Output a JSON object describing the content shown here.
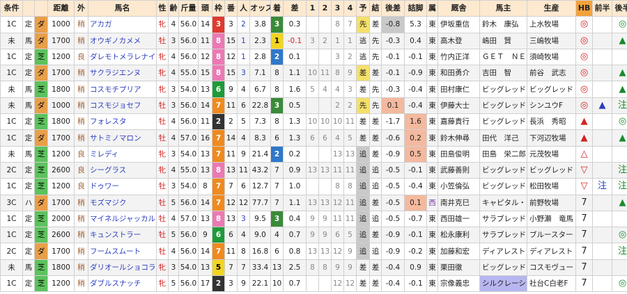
{
  "headers": [
    "条件",
    "",
    "",
    "距離",
    "外",
    "馬名",
    "性",
    "齢",
    "斤量",
    "頭",
    "枠",
    "番",
    "人",
    "オッズ",
    "着",
    "差",
    "1",
    "2",
    "3",
    "4",
    "予",
    "結",
    "後差",
    "詰脚",
    "属",
    "厩舎",
    "馬主",
    "生産",
    "HB",
    "前半",
    "後半"
  ],
  "waku_colors": {
    "1": {
      "bg": "#ffffff",
      "fg": "#000000"
    },
    "2": {
      "bg": "#333333",
      "fg": "#ffffff"
    },
    "3": {
      "bg": "#e03a2e",
      "fg": "#ffffff"
    },
    "4": {
      "bg": "#2f63c9",
      "fg": "#ffffff"
    },
    "5": {
      "bg": "#f1d520",
      "fg": "#000000"
    },
    "6": {
      "bg": "#1f9a3a",
      "fg": "#ffffff"
    },
    "7": {
      "bg": "#f08a1e",
      "fg": "#ffffff"
    },
    "8": {
      "bg": "#ec79b4",
      "fg": "#ffffff"
    }
  },
  "finish_colors": {
    "1": {
      "bg": "#f1d520",
      "fg": "#000000"
    },
    "2": {
      "bg": "#2f78c9",
      "fg": "#ffffff"
    },
    "3": {
      "bg": "#3a8a3a",
      "fg": "#ffffff"
    },
    "other": {
      "bg": "",
      "fg": "#222222"
    }
  },
  "rows": [
    {
      "cls": "1C",
      "kind": "定",
      "surf": "ダ",
      "dist": "1000",
      "soto": "稍",
      "name": "アカガ",
      "sex": "牝",
      "age": "4",
      "kin": "56.0",
      "tou": "14",
      "waku": "3",
      "ban": "3",
      "nin": "2",
      "odds": "3.8",
      "chaku": "3",
      "sa": "0.3",
      "c1": "",
      "c2": "",
      "c3": "8",
      "c4": "7",
      "yo": "先",
      "yo_style": "cell-yellow",
      "ketsu": "差",
      "gosa": "-0.8",
      "gosa_style": "cell-gray",
      "tsume": "5.3",
      "tsume_style": "",
      "zoku": "東",
      "kyu": "伊坂重信",
      "owner": "鈴木　康弘",
      "owner_style": "",
      "sei": "上水牧場",
      "hb": "◎",
      "hb_cls": "mark-red",
      "zen": "",
      "kou": "◎",
      "kou_cls": "mark-green"
    },
    {
      "cls": "未",
      "kind": "馬",
      "surf": "ダ",
      "dist": "1700",
      "soto": "稍",
      "name": "オウギノカメメ",
      "sex": "牡",
      "age": "3",
      "kin": "56.0",
      "tou": "11",
      "waku": "8",
      "ban": "15",
      "nin": "1",
      "odds": "2.3",
      "chaku": "1",
      "sa": "-0.1",
      "c1": "3",
      "c2": "2",
      "c3": "1",
      "c4": "1",
      "yo": "逃",
      "yo_style": "",
      "ketsu": "先",
      "gosa": "-0.3",
      "gosa_style": "",
      "tsume": "0.4",
      "tsume_style": "",
      "zoku": "東",
      "kyu": "高木登",
      "owner": "嶋田　賢",
      "owner_style": "",
      "sei": "三嶋牧場",
      "hb": "◎",
      "hb_cls": "mark-red",
      "zen": "",
      "kou": "▲",
      "kou_cls": "mark-green"
    },
    {
      "cls": "1C",
      "kind": "定",
      "surf": "芝",
      "dist": "1200",
      "soto": "良",
      "name": "ダレモトメラレナイ",
      "sex": "牝",
      "age": "4",
      "kin": "56.0",
      "tou": "12",
      "waku": "8",
      "ban": "12",
      "nin": "1",
      "odds": "2.8",
      "chaku": "2",
      "sa": "0.1",
      "c1": "",
      "c2": "",
      "c3": "3",
      "c4": "2",
      "yo": "逃",
      "yo_style": "",
      "ketsu": "先",
      "gosa": "-0.1",
      "gosa_style": "",
      "tsume": "-0.1",
      "tsume_style": "",
      "zoku": "東",
      "kyu": "竹内正洋",
      "owner": "ＧＥＴ　ＮＥ",
      "owner_style": "",
      "sei": "須崎牧場",
      "hb": "◎",
      "hb_cls": "mark-red",
      "zen": "",
      "kou": "",
      "kou_cls": ""
    },
    {
      "cls": "1C",
      "kind": "定",
      "surf": "ダ",
      "dist": "1700",
      "soto": "稍",
      "name": "サクラジエンヌ",
      "sex": "牝",
      "age": "4",
      "kin": "55.0",
      "tou": "15",
      "waku": "8",
      "ban": "15",
      "nin": "3",
      "odds": "7.1",
      "chaku": "8",
      "sa": "1.1",
      "c1": "10",
      "c2": "11",
      "c3": "8",
      "c4": "9",
      "yo": "差",
      "yo_style": "cell-yellow",
      "ketsu": "差",
      "gosa": "-0.1",
      "gosa_style": "",
      "tsume": "-0.9",
      "tsume_style": "",
      "zoku": "東",
      "kyu": "和田勇介",
      "owner": "吉田　智",
      "owner_style": "",
      "sei": "前谷　武志",
      "hb": "◎",
      "hb_cls": "mark-red",
      "zen": "",
      "kou": "▲",
      "kou_cls": "mark-green"
    },
    {
      "cls": "未",
      "kind": "馬",
      "surf": "芝",
      "dist": "1800",
      "soto": "稍",
      "name": "コスモチプリア",
      "sex": "牝",
      "age": "3",
      "kin": "54.0",
      "tou": "13",
      "waku": "6",
      "ban": "9",
      "nin": "4",
      "odds": "6.7",
      "chaku": "8",
      "sa": "1.6",
      "c1": "5",
      "c2": "4",
      "c3": "4",
      "c4": "3",
      "yo": "差",
      "yo_style": "",
      "ketsu": "先",
      "gosa": "-0.3",
      "gosa_style": "",
      "tsume": "-0.4",
      "tsume_style": "",
      "zoku": "東",
      "kyu": "田村康仁",
      "owner": "ビッグレッド",
      "owner_style": "",
      "sei": "ビッグレッド",
      "hb": "◎",
      "hb_cls": "mark-red",
      "zen": "",
      "kou": "▲",
      "kou_cls": "mark-green"
    },
    {
      "cls": "未",
      "kind": "馬",
      "surf": "ダ",
      "dist": "1000",
      "soto": "稍",
      "name": "コスモジョセフ",
      "sex": "牡",
      "age": "3",
      "kin": "56.0",
      "tou": "14",
      "waku": "7",
      "ban": "11",
      "nin": "6",
      "odds": "22.8",
      "chaku": "3",
      "sa": "0.5",
      "c1": "",
      "c2": "",
      "c3": "2",
      "c4": "2",
      "yo": "先",
      "yo_style": "cell-yellow",
      "ketsu": "先",
      "gosa": "0.1",
      "gosa_style": "cell-salmon",
      "tsume": "-0.4",
      "tsume_style": "",
      "zoku": "東",
      "kyu": "伊藤大士",
      "owner": "ビッグレッド",
      "owner_style": "",
      "sei": "シンユウF",
      "hb": "◎",
      "hb_cls": "mark-red",
      "zen": "▲",
      "zen_cls": "mark-blue",
      "kou": "注",
      "kou_cls": "mark-green"
    },
    {
      "cls": "1C",
      "kind": "定",
      "surf": "芝",
      "dist": "1800",
      "soto": "稍",
      "name": "フォレスタ",
      "sex": "牡",
      "age": "4",
      "kin": "56.0",
      "tou": "11",
      "waku": "2",
      "ban": "2",
      "nin": "5",
      "odds": "7.3",
      "chaku": "8",
      "sa": "1.3",
      "c1": "10",
      "c2": "10",
      "c3": "10",
      "c4": "11",
      "yo": "差",
      "yo_style": "",
      "ketsu": "差",
      "gosa": "-1.7",
      "gosa_style": "",
      "tsume": "1.6",
      "tsume_style": "cell-salmon",
      "zoku": "東",
      "kyu": "嘉藤貴行",
      "owner": "ビッグレッド",
      "owner_style": "",
      "sei": "長浜　秀昭",
      "hb": "▲",
      "hb_cls": "mark-red",
      "zen": "",
      "kou": "◎",
      "kou_cls": "mark-green"
    },
    {
      "cls": "1C",
      "kind": "定",
      "surf": "ダ",
      "dist": "1700",
      "soto": "稍",
      "name": "サトミノマロン",
      "sex": "牡",
      "age": "4",
      "kin": "57.0",
      "tou": "16",
      "waku": "7",
      "ban": "14",
      "nin": "4",
      "odds": "8.3",
      "chaku": "6",
      "sa": "1.3",
      "c1": "6",
      "c2": "6",
      "c3": "4",
      "c4": "5",
      "yo": "差",
      "yo_style": "",
      "ketsu": "差",
      "gosa": "-0.6",
      "gosa_style": "",
      "tsume": "0.2",
      "tsume_style": "cell-salmon",
      "zoku": "東",
      "kyu": "鈴木伸尋",
      "owner": "田代　洋己",
      "owner_style": "",
      "sei": "下河辺牧場",
      "hb": "▲",
      "hb_cls": "mark-red",
      "zen": "",
      "kou": "▲",
      "kou_cls": "mark-green"
    },
    {
      "cls": "未",
      "kind": "馬",
      "surf": "芝",
      "dist": "1200",
      "soto": "良",
      "name": "ミレディ",
      "sex": "牝",
      "age": "3",
      "kin": "54.0",
      "tou": "13",
      "waku": "7",
      "ban": "11",
      "nin": "9",
      "odds": "21.4",
      "chaku": "2",
      "sa": "0.2",
      "c1": "",
      "c2": "",
      "c3": "13",
      "c4": "13",
      "yo": "追",
      "yo_style": "cell-gray",
      "ketsu": "差",
      "gosa": "-0.9",
      "gosa_style": "",
      "tsume": "0.5",
      "tsume_style": "cell-salmon",
      "zoku": "東",
      "kyu": "田島俊明",
      "owner": "田島　栄二郎",
      "owner_style": "",
      "sei": "元茂牧場",
      "hb": "△",
      "hb_cls": "mark-red",
      "zen": "",
      "kou": "",
      "kou_cls": ""
    },
    {
      "cls": "2C",
      "kind": "定",
      "surf": "芝",
      "dist": "2600",
      "soto": "良",
      "name": "シーグラス",
      "sex": "牝",
      "age": "4",
      "kin": "55.0",
      "tou": "13",
      "waku": "8",
      "ban": "13",
      "nin": "11",
      "odds": "43.2",
      "chaku": "7",
      "sa": "0.9",
      "c1": "13",
      "c2": "13",
      "c3": "11",
      "c4": "11",
      "yo": "追",
      "yo_style": "cell-gray",
      "ketsu": "追",
      "gosa": "-0.5",
      "gosa_style": "",
      "tsume": "-0.1",
      "tsume_style": "",
      "zoku": "東",
      "kyu": "武藤善則",
      "owner": "ビッグレッド",
      "owner_style": "",
      "sei": "ビッグレッド",
      "hb": "▽",
      "hb_cls": "mark-red",
      "zen": "",
      "kou": "注",
      "kou_cls": "mark-green"
    },
    {
      "cls": "1C",
      "kind": "定",
      "surf": "芝",
      "dist": "1200",
      "soto": "良",
      "name": "ドゥワー",
      "sex": "牡",
      "age": "3",
      "kin": "54.0",
      "tou": "8",
      "waku": "7",
      "ban": "7",
      "nin": "6",
      "odds": "12.7",
      "chaku": "7",
      "sa": "1.0",
      "c1": "",
      "c2": "",
      "c3": "8",
      "c4": "8",
      "yo": "追",
      "yo_style": "cell-gray",
      "ketsu": "追",
      "gosa": "-0.5",
      "gosa_style": "",
      "tsume": "-0.4",
      "tsume_style": "",
      "zoku": "東",
      "kyu": "小笠倫弘",
      "owner": "ビッグレッド",
      "owner_style": "",
      "sei": "松田牧場",
      "hb": "▽",
      "hb_cls": "mark-red",
      "zen": "注",
      "zen_cls": "mark-blue",
      "kou": "注",
      "kou_cls": "mark-green"
    },
    {
      "cls": "3C",
      "kind": "ハ",
      "surf": "ダ",
      "dist": "1700",
      "soto": "稍",
      "name": "モズマジク",
      "sex": "牡",
      "age": "5",
      "kin": "56.0",
      "tou": "14",
      "waku": "7",
      "ban": "12",
      "nin": "12",
      "odds": "77.7",
      "chaku": "7",
      "sa": "1.1",
      "c1": "13",
      "c2": "13",
      "c3": "12",
      "c4": "11",
      "yo": "追",
      "yo_style": "cell-gray",
      "ketsu": "差",
      "gosa": "-0.5",
      "gosa_style": "",
      "tsume": "0.1",
      "tsume_style": "cell-salmon",
      "zoku": "西",
      "zoku_cls": "purpletxt",
      "kyu": "南井克巳",
      "owner": "キャピタル・",
      "owner_style": "",
      "sei": "前野牧場",
      "hb": "7",
      "hb_cls": "",
      "zen": "",
      "kou": "▲",
      "kou_cls": "mark-green"
    },
    {
      "cls": "1C",
      "kind": "定",
      "surf": "芝",
      "dist": "2000",
      "soto": "稍",
      "name": "マイネルジャッカル",
      "sex": "牡",
      "age": "4",
      "kin": "57.0",
      "tou": "13",
      "waku": "8",
      "ban": "13",
      "nin": "3",
      "odds": "9.5",
      "chaku": "3",
      "sa": "0.4",
      "c1": "9",
      "c2": "9",
      "c3": "11",
      "c4": "11",
      "yo": "追",
      "yo_style": "cell-gray",
      "ketsu": "追",
      "gosa": "-0.5",
      "gosa_style": "",
      "tsume": "-0.7",
      "tsume_style": "",
      "zoku": "東",
      "kyu": "西田雄一",
      "owner": "サラブレッド",
      "owner_style": "",
      "sei": "小野瀬　竜馬",
      "hb": "7",
      "hb_cls": "",
      "zen": "",
      "kou": "",
      "kou_cls": ""
    },
    {
      "cls": "1C",
      "kind": "定",
      "surf": "芝",
      "dist": "2600",
      "soto": "稍",
      "name": "キュンストラー",
      "sex": "牡",
      "age": "5",
      "kin": "56.0",
      "tou": "9",
      "waku": "6",
      "ban": "6",
      "nin": "4",
      "odds": "9.0",
      "chaku": "4",
      "sa": "0.7",
      "c1": "9",
      "c2": "9",
      "c3": "6",
      "c4": "5",
      "yo": "追",
      "yo_style": "cell-gray",
      "ketsu": "差",
      "gosa": "-0.9",
      "gosa_style": "",
      "tsume": "-0.1",
      "tsume_style": "",
      "zoku": "東",
      "kyu": "松永康利",
      "owner": "サラブレッド",
      "owner_style": "",
      "sei": "ブルースター",
      "hb": "7",
      "hb_cls": "",
      "zen": "",
      "kou": "◎",
      "kou_cls": "mark-green"
    },
    {
      "cls": "2C",
      "kind": "定",
      "surf": "ダ",
      "dist": "1700",
      "soto": "稍",
      "name": "フームスムート",
      "sex": "牡",
      "age": "4",
      "kin": "56.0",
      "tou": "14",
      "waku": "7",
      "ban": "11",
      "nin": "8",
      "odds": "16.8",
      "chaku": "6",
      "sa": "0.8",
      "c1": "13",
      "c2": "13",
      "c3": "12",
      "c4": "9",
      "yo": "追",
      "yo_style": "cell-gray",
      "ketsu": "追",
      "gosa": "-0.9",
      "gosa_style": "",
      "tsume": "-0.2",
      "tsume_style": "",
      "zoku": "東",
      "kyu": "加藤和宏",
      "owner": "ディアレスト",
      "owner_style": "",
      "sei": "ディアレスト",
      "hb": "7",
      "hb_cls": "",
      "zen": "",
      "kou": "注",
      "kou_cls": "mark-green"
    },
    {
      "cls": "未",
      "kind": "馬",
      "surf": "芝",
      "dist": "1800",
      "soto": "稍",
      "name": "ダリオールショコラ",
      "sex": "牝",
      "age": "3",
      "kin": "54.0",
      "tou": "13",
      "waku": "5",
      "ban": "7",
      "nin": "7",
      "odds": "33.4",
      "chaku": "13",
      "sa": "2.5",
      "c1": "8",
      "c2": "8",
      "c3": "9",
      "c4": "9",
      "yo": "差",
      "yo_style": "",
      "ketsu": "差",
      "gosa": "-0.4",
      "gosa_style": "",
      "tsume": "0.9",
      "tsume_style": "",
      "zoku": "東",
      "kyu": "栗田徹",
      "owner": "ビッグレッド",
      "owner_style": "",
      "sei": "コスモヴュー",
      "hb": "7",
      "hb_cls": "",
      "zen": "",
      "kou": "",
      "kou_cls": ""
    },
    {
      "cls": "1C",
      "kind": "定",
      "surf": "芝",
      "dist": "1200",
      "soto": "稍",
      "name": "ダブルスナッチ",
      "sex": "牝",
      "age": "5",
      "kin": "56.0",
      "tou": "17",
      "waku": "2",
      "ban": "3",
      "nin": "9",
      "odds": "22.1",
      "chaku": "10",
      "sa": "0.7",
      "c1": "",
      "c2": "",
      "c3": "12",
      "c4": "12",
      "yo": "差",
      "yo_style": "",
      "ketsu": "差",
      "gosa": "-0.4",
      "gosa_style": "",
      "tsume": "-0.1",
      "tsume_style": "",
      "zoku": "東",
      "kyu": "宗像義忠",
      "owner": "シルクレーシ",
      "owner_style": "cell-lav",
      "sei": "社台C白老F",
      "hb": "7",
      "hb_cls": "",
      "zen": "",
      "kou": "◎",
      "kou_cls": "mark-green"
    }
  ]
}
